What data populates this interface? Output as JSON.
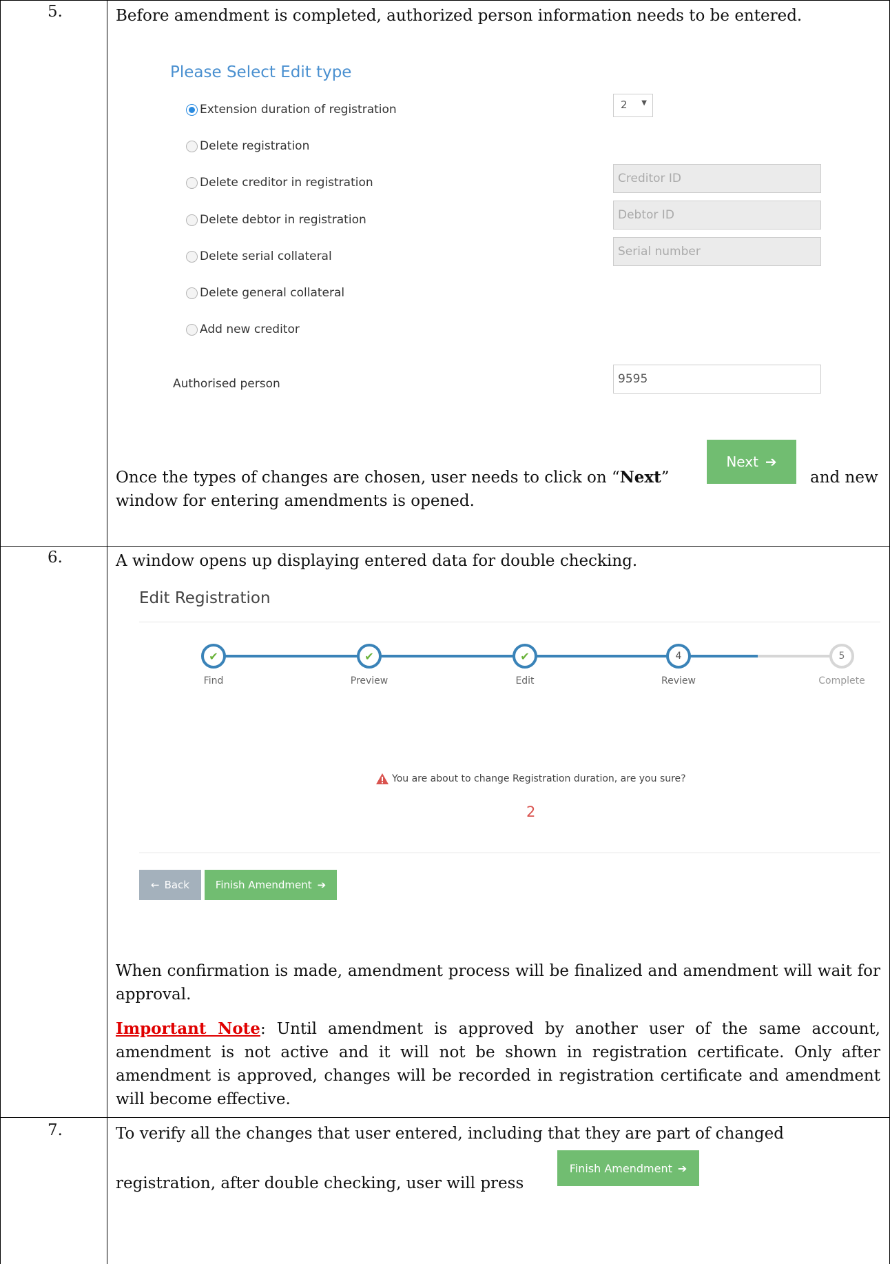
{
  "rows": [
    {
      "number": "5.",
      "intro": "Before amendment is completed, authorized person information needs to be entered.",
      "form": {
        "heading": "Please Select Edit type",
        "options": [
          {
            "label": "Extension duration of registration",
            "checked": true
          },
          {
            "label": "Delete registration",
            "checked": false
          },
          {
            "label": "Delete creditor in registration",
            "checked": false
          },
          {
            "label": "Delete debtor in registration",
            "checked": false
          },
          {
            "label": "Delete serial collateral",
            "checked": false
          },
          {
            "label": "Delete general collateral",
            "checked": false
          },
          {
            "label": "Add new creditor",
            "checked": false
          }
        ],
        "duration_value": "2",
        "creditor_placeholder": "Creditor ID",
        "debtor_placeholder": "Debtor ID",
        "serial_placeholder": "Serial number",
        "authorised_label": "Authorised person",
        "authorised_value": "9595"
      },
      "next_text_before": "Once the types of changes are chosen, user needs to click on “",
      "next_bold": "Next",
      "next_text_after": "”",
      "next_button": "Next",
      "next_text_tail": "and new",
      "next_text_line2": "window for entering amendments is opened."
    },
    {
      "number": "6.",
      "intro": "A window opens up displaying entered data for double checking.",
      "panel": {
        "title": "Edit Registration",
        "steps": [
          {
            "label": "Find",
            "marker": "✔",
            "state": "done"
          },
          {
            "label": "Preview",
            "marker": "✔",
            "state": "done"
          },
          {
            "label": "Edit",
            "marker": "✔",
            "state": "done"
          },
          {
            "label": "Review",
            "marker": "4",
            "state": "current"
          },
          {
            "label": "Complete",
            "marker": "5",
            "state": "pending"
          }
        ],
        "warning": "You are about to change Registration duration, are you sure?",
        "value": "2",
        "back_button": "Back",
        "finish_button": "Finish Amendment"
      },
      "confirmation_text": "When confirmation is made, amendment process will be finalized and amendment will wait for approval.",
      "note_label": "Important Note",
      "note_text": ": Until amendment is approved by another user of the same account, amendment is not active and it will not be shown in registration certificate. Only after amendment is approved, changes will be recorded in registration certificate and amendment will become effective."
    },
    {
      "number": "7.",
      "text_line1": "To verify all the changes that user entered, including that they are part of changed",
      "text_line2": "registration, after double checking, user will press",
      "finish_button": "Finish Amendment"
    }
  ],
  "colors": {
    "green_button": "#71bd71",
    "grey_button": "#a4b1bc",
    "step_blue": "#3a83b8",
    "heading_blue": "#4a90d0",
    "warning_red": "#d9534f",
    "note_red": "#e00000"
  }
}
